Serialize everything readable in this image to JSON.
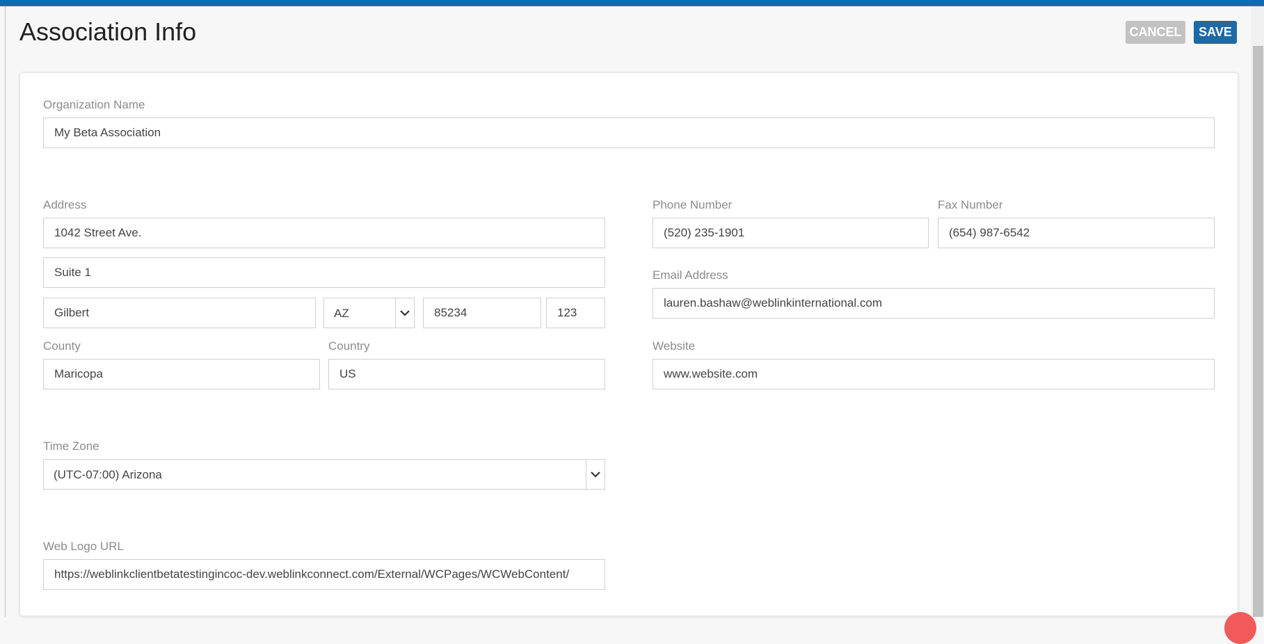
{
  "page": {
    "title": "Association Info",
    "cancel_label": "CANCEL",
    "save_label": "SAVE"
  },
  "form": {
    "organization_name": {
      "label": "Organization Name",
      "value": "My Beta Association"
    },
    "address": {
      "label": "Address",
      "line1": "1042 Street Ave.",
      "line2": "Suite 1",
      "city": "Gilbert",
      "state": "AZ",
      "zip": "85234",
      "zip_ext": "123"
    },
    "county": {
      "label": "County",
      "value": "Maricopa"
    },
    "country": {
      "label": "Country",
      "value": "US"
    },
    "phone": {
      "label": "Phone Number",
      "value": "(520) 235-1901"
    },
    "fax": {
      "label": "Fax Number",
      "value": "(654) 987-6542"
    },
    "email": {
      "label": "Email Address",
      "value": "lauren.bashaw@weblinkinternational.com"
    },
    "website": {
      "label": "Website",
      "value": "www.website.com"
    },
    "time_zone": {
      "label": "Time Zone",
      "value": "(UTC-07:00) Arizona"
    },
    "web_logo_url": {
      "label": "Web Logo URL",
      "value": "https://weblinkclientbetatestingincoc-dev.weblinkconnect.com/External/WCPages/WCWebContent/"
    }
  },
  "colors": {
    "accent": "#0c6ea8",
    "save_button": "#1d6aa5",
    "cancel_button": "#c2c2c2"
  },
  "icons": {
    "dropdown": "chevron-down-icon"
  }
}
